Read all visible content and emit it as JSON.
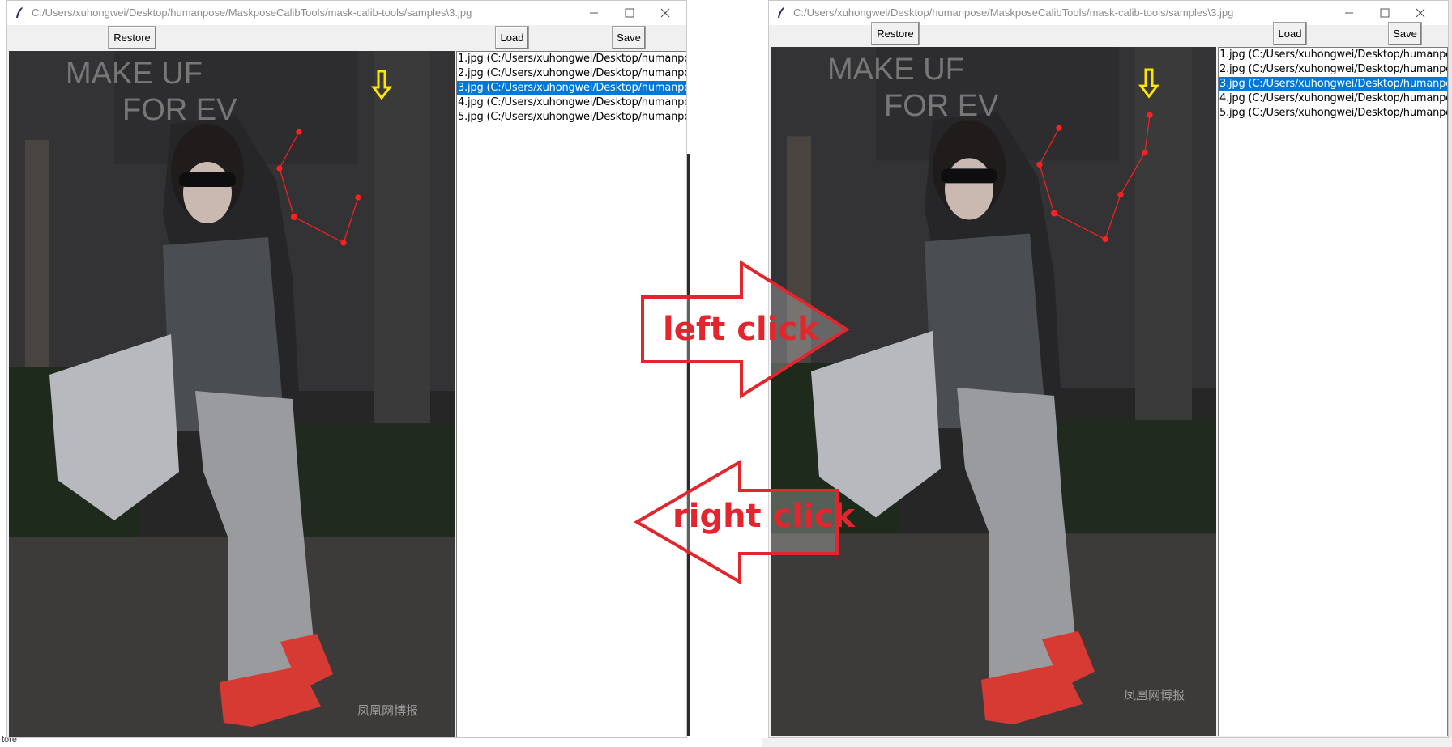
{
  "windows": [
    {
      "title": "C:/Users/xuhongwei/Desktop/humanpose/MaskposeCalibTools/mask-calib-tools/samples\\3.jpg",
      "buttons": {
        "restore": "Restore",
        "load": "Load",
        "save": "Save"
      },
      "files": [
        "1.jpg (C:/Users/xuhongwei/Desktop/humanpose",
        "2.jpg (C:/Users/xuhongwei/Desktop/humanpose",
        "3.jpg (C:/Users/xuhongwei/Desktop/humanpose",
        "4.jpg (C:/Users/xuhongwei/Desktop/humanpose",
        "5.jpg (C:/Users/xuhongwei/Desktop/humanpose"
      ],
      "selected_index": 2,
      "watermark": "凤凰网博报"
    },
    {
      "title": "C:/Users/xuhongwei/Desktop/humanpose/MaskposeCalibTools/mask-calib-tools/samples\\3.jpg",
      "buttons": {
        "restore": "Restore",
        "load": "Load",
        "save": "Save"
      },
      "files": [
        "1.jpg (C:/Users/xuhongwei/Desktop/humanpose",
        "2.jpg (C:/Users/xuhongwei/Desktop/humanpose",
        "3.jpg (C:/Users/xuhongwei/Desktop/humanpose",
        "4.jpg (C:/Users/xuhongwei/Desktop/humanpose",
        "5.jpg (C:/Users/xuhongwei/Desktop/humanpose"
      ],
      "selected_index": 2,
      "watermark": "凤凰网博报"
    }
  ],
  "annotations": {
    "left_click": "left click",
    "right_click": "right click"
  },
  "status_text": "tore",
  "colors": {
    "accent_red": "#e3262e",
    "keypoint_red": "#ff2020",
    "marker_yellow": "#ffe600",
    "selection_blue": "#0078d7"
  }
}
